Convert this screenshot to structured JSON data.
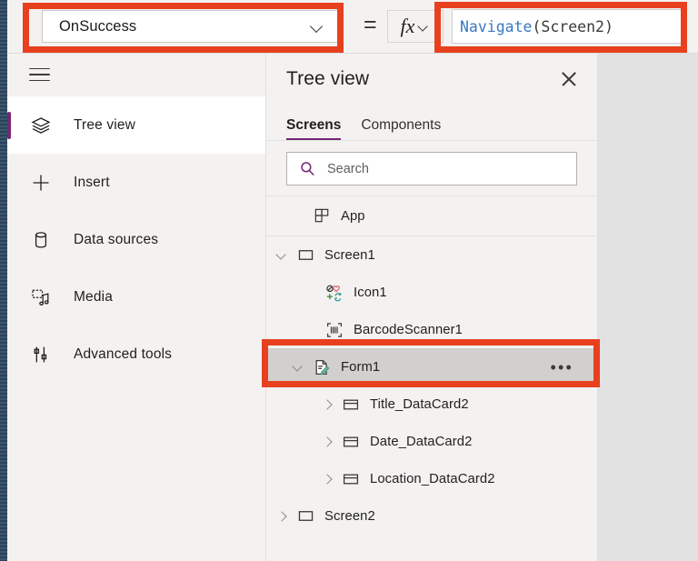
{
  "formula_bar": {
    "property_dropdown": {
      "value": "OnSuccess",
      "chevron_icon": "chevron-down-icon"
    },
    "equals": "=",
    "fx_button": {
      "glyph": "fx",
      "chevron_icon": "chevron-down-icon"
    },
    "formula": {
      "function_token": "Navigate",
      "rest_token": "(Screen2)",
      "full_text": "Navigate(Screen2)"
    }
  },
  "sidebar": {
    "hamburger_icon": "hamburger-menu-icon",
    "items": [
      {
        "label": "Tree view",
        "icon": "layers-icon",
        "active": true
      },
      {
        "label": "Insert",
        "icon": "plus-icon",
        "active": false
      },
      {
        "label": "Data sources",
        "icon": "database-icon",
        "active": false
      },
      {
        "label": "Media",
        "icon": "media-icon",
        "active": false
      },
      {
        "label": "Advanced tools",
        "icon": "advanced-tools-icon",
        "active": false
      }
    ]
  },
  "tree_panel": {
    "title": "Tree view",
    "close_icon": "close-icon",
    "tabs": [
      {
        "label": "Screens",
        "active": true
      },
      {
        "label": "Components",
        "active": false
      }
    ],
    "search": {
      "placeholder": "Search",
      "value": "",
      "icon": "search-icon"
    },
    "rows": [
      {
        "label": "App",
        "icon": "app-icon",
        "level": 0,
        "chevron": "none",
        "selected": false,
        "menu": false
      },
      {
        "label": "Screen1",
        "icon": "screen-icon",
        "level": 0,
        "chevron": "expanded",
        "selected": false,
        "menu": false
      },
      {
        "label": "Icon1",
        "icon": "icons-gallery-icon",
        "level": 1,
        "chevron": "none",
        "selected": false,
        "menu": false
      },
      {
        "label": "BarcodeScanner1",
        "icon": "barcode-scanner-icon",
        "level": 1,
        "chevron": "none",
        "selected": false,
        "menu": false
      },
      {
        "label": "Form1",
        "icon": "form-edit-icon",
        "level": 2,
        "chevron": "expanded",
        "selected": true,
        "menu": true
      },
      {
        "label": "Title_DataCard2",
        "icon": "data-card-icon",
        "level": 3,
        "chevron": "collapsed",
        "selected": false,
        "menu": false
      },
      {
        "label": "Date_DataCard2",
        "icon": "data-card-icon",
        "level": 3,
        "chevron": "collapsed",
        "selected": false,
        "menu": false
      },
      {
        "label": "Location_DataCard2",
        "icon": "data-card-icon",
        "level": 3,
        "chevron": "collapsed",
        "selected": false,
        "menu": false
      },
      {
        "label": "Screen2",
        "icon": "screen-icon",
        "level": 0,
        "chevron": "collapsed",
        "selected": false,
        "menu": false
      }
    ],
    "row_menu_glyph": "•••"
  },
  "annotations": {
    "color": "#e8401f",
    "boxes": [
      "property-dropdown",
      "formula-input",
      "form1-tree-row"
    ]
  },
  "colors": {
    "accent_purple": "#742774",
    "annotation_red": "#e8401f",
    "panel_bg": "#f3f2f1",
    "selected_row": "#d2d0ce",
    "formula_function": "#3b78c3"
  }
}
